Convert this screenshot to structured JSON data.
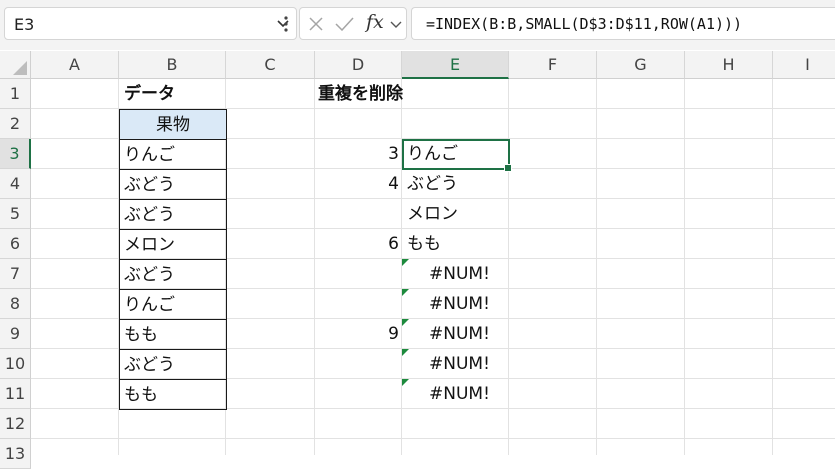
{
  "name_box": {
    "value": "E3"
  },
  "formula_bar": {
    "icons": [
      "cancel-icon",
      "enter-icon",
      "fx-icon"
    ],
    "fx_label": "fx",
    "formula": "=INDEX(B:B,SMALL(D$3:D$11,ROW(A1)))"
  },
  "columns": [
    "A",
    "B",
    "C",
    "D",
    "E",
    "F",
    "G",
    "H",
    "I"
  ],
  "rows": [
    "1",
    "2",
    "3",
    "4",
    "5",
    "6",
    "7",
    "8",
    "9",
    "10",
    "11",
    "12",
    "13"
  ],
  "active_cell": {
    "column": "E",
    "row": "3"
  },
  "cells": {
    "B1": "データ",
    "D1": "重複を削除",
    "table": {
      "header": "果物",
      "items": [
        "りんご",
        "ぶどう",
        "ぶどう",
        "メロン",
        "ぶどう",
        "りんご",
        "もも",
        "ぶどう",
        "もも"
      ]
    },
    "column_d": [
      "3",
      "4",
      "",
      "6",
      "",
      "",
      "9",
      "",
      ""
    ],
    "column_e": [
      "りんご",
      "ぶどう",
      "メロン",
      "もも",
      "#NUM!",
      "#NUM!",
      "#NUM!",
      "#NUM!",
      "#NUM!"
    ]
  },
  "colors": {
    "accent": "#1e7145",
    "table_header_fill": "#dae9f7",
    "error_indicator": "#1d8a3d"
  }
}
